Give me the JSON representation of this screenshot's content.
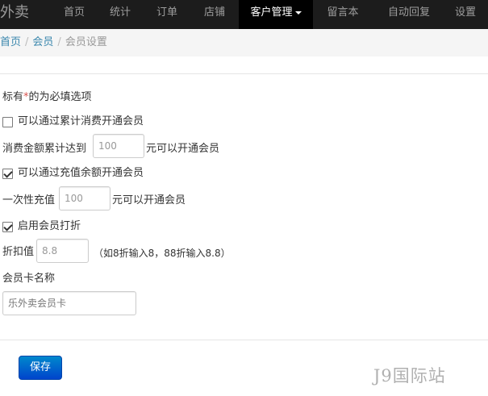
{
  "navbar": {
    "brand": "乐外卖",
    "items": [
      {
        "label": "首页",
        "active": false
      },
      {
        "label": "统计",
        "active": false
      },
      {
        "label": "订单",
        "active": false
      },
      {
        "label": "店铺",
        "active": false
      },
      {
        "label": "客户管理",
        "active": true
      },
      {
        "label": "留言本",
        "active": false
      },
      {
        "label": "自动回复",
        "active": false
      },
      {
        "label": "设置",
        "active": false
      }
    ]
  },
  "breadcrumb": {
    "home": "首页",
    "members": "会员",
    "current": "会员设置",
    "separator": "/"
  },
  "form": {
    "required_note_prefix": "标有",
    "required_mark": "*",
    "required_note_suffix": "的为必填选项",
    "cumulative": {
      "checkbox_label": "可以通过累计消费开通会员",
      "checked": false,
      "prefix": "消费金额累计达到",
      "value": "100",
      "suffix": "元可以开通会员"
    },
    "recharge": {
      "checkbox_label": "可以通过充值余额开通会员",
      "checked": true,
      "prefix": "一次性充值",
      "value": "100",
      "suffix": "元可以开通会员"
    },
    "discount": {
      "checkbox_label": "启用会员打折",
      "checked": true,
      "prefix": "折扣值",
      "value": "8.8",
      "hint": "（如8折输入8，88折输入8.8）"
    },
    "card_name": {
      "label": "会员卡名称",
      "placeholder": "乐外卖会员卡"
    },
    "save_label": "保存"
  },
  "watermark": "J9国际站",
  "colors": {
    "navbar_bg": "#1c1c1c",
    "active_nav_bg": "#000000",
    "link": "#3a87ad",
    "primary_button": "#0066cc",
    "required": "#d9534f"
  }
}
